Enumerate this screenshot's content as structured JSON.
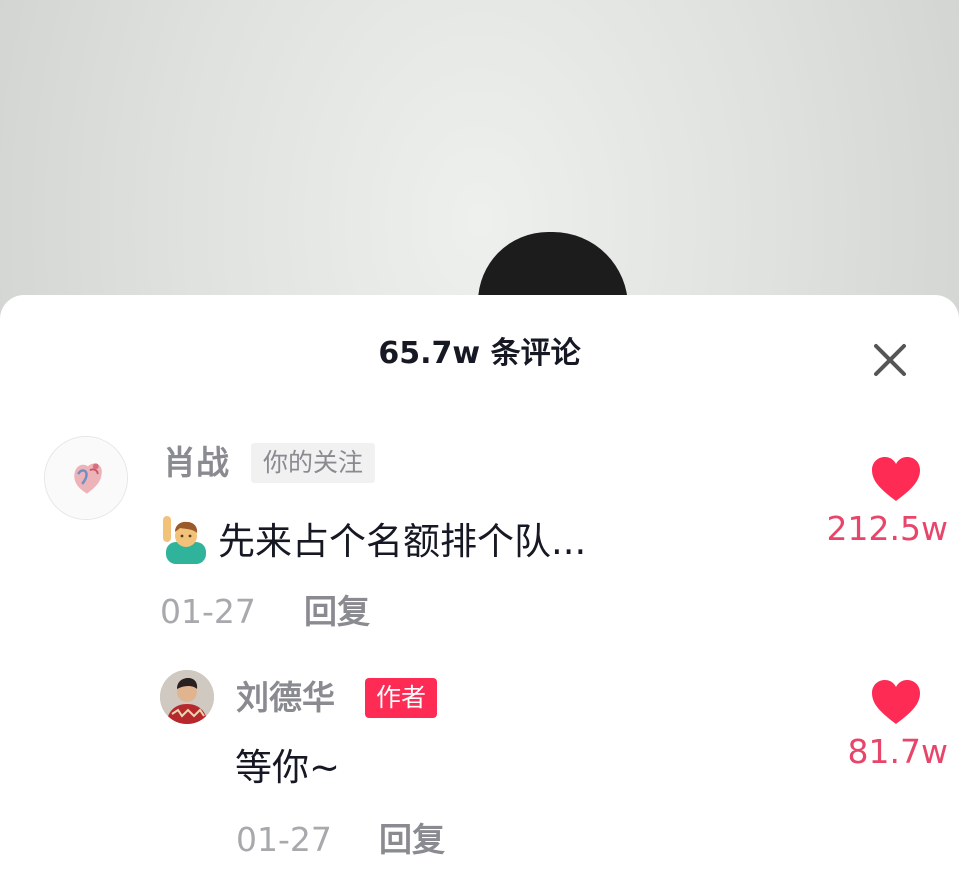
{
  "header": {
    "title": "65.7w 条评论",
    "close_icon": "close-icon"
  },
  "comments": [
    {
      "username": "肖战",
      "tag": "你的关注",
      "emoji_icon": "person-raising-hand-icon",
      "text": "先来占个名额排个队...",
      "date": "01-27",
      "reply_label": "回复",
      "like_count": "212.5w"
    },
    {
      "username": "刘德华",
      "tag": "作者",
      "text": "等你~",
      "date": "01-27",
      "reply_label": "回复",
      "like_count": "81.7w"
    }
  ],
  "colors": {
    "accent": "#fe2c55",
    "like": "#fe2c55",
    "like_count": "#e8456a",
    "muted": "#8a8b91"
  }
}
